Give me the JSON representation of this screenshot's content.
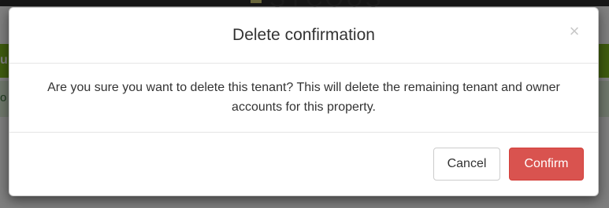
{
  "background": {
    "logo_text": "SYCOUS",
    "greenbar_text": "u",
    "alert_text": "o"
  },
  "modal": {
    "title": "Delete confirmation",
    "close_glyph": "×",
    "message": "Are you sure you want to delete this tenant? This will delete the remaining tenant and owner accounts for this property.",
    "buttons": {
      "cancel_label": "Cancel",
      "confirm_label": "Confirm"
    }
  },
  "colors": {
    "confirm_button": "#d9534f",
    "green_bar": "#7eb81f",
    "alert_bg": "#dff0d8"
  }
}
